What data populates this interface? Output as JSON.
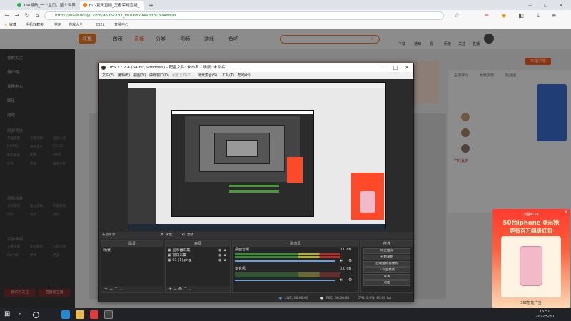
{
  "browser": {
    "tabs": [
      {
        "label": "360导航_一个主页，整个世界"
      },
      {
        "label": "YTG夏天直播_王者荣耀直播_"
      }
    ],
    "url": "https://www.douyu.com/96067787_r=0.68774933303248818",
    "bookmarks": [
      "收藏",
      "手机收藏夹",
      "常用",
      "游戏大全",
      "2021",
      "直播中心"
    ]
  },
  "douyu": {
    "logo": "斗鱼",
    "nav": [
      "首页",
      "直播",
      "分类",
      "视频",
      "游戏",
      "鱼吧"
    ],
    "active_nav": "直播",
    "header_right": [
      "下载",
      "通知",
      "看",
      "历史",
      "关注",
      "直播"
    ],
    "sidebar": {
      "top_items": [
        "我的关注",
        "排行榜",
        "兑换中心",
        "娱乐",
        "游戏"
      ],
      "section1_title": "网游竞技",
      "section1_games": [
        "英雄联盟",
        "王者荣耀",
        "穿越火线",
        "DOTA2",
        "绝地求生",
        "CS:GO",
        "和平精英",
        "DNF",
        "APEX",
        "吃鸡",
        "传奇",
        "魔兽世界"
      ],
      "section2_title": "单机热游",
      "section2_games": [
        "主机游戏",
        "独立游戏",
        "怀旧游戏",
        "单机",
        "动作",
        "冒险"
      ],
      "section3_title": "手游休闲",
      "section3_games": [
        "王者荣耀",
        "和平精英",
        "火影忍者",
        "QQ飞车",
        "原神",
        "更多"
      ],
      "bottom_buttons": [
        "我的已关注",
        "直播找主播"
      ]
    },
    "right_panel": {
      "tabs": [
        "主播排行",
        "贡献周榜",
        "粉丝团"
      ],
      "chat_user": "YTG夏天",
      "badge": "PC客户端"
    }
  },
  "obs": {
    "title": "OBS 27.2.4 (64-bit, windows) - 配置文件: 未命名 - 场景: 未命名",
    "menu": [
      "文件(F)",
      "编辑(E)",
      "视图(V)",
      "停靠窗口(D)",
      "配置文件(P)",
      "场景集合(S)",
      "工具(T)",
      "帮助(H)"
    ],
    "status_label": "未选择源",
    "props_label": "属性",
    "filters_label": "滤镜",
    "docks": {
      "scenes": {
        "title": "场景",
        "items": [
          "场景"
        ]
      },
      "sources": {
        "title": "来源",
        "items": [
          "显示器采集",
          "窗口采集",
          "01 (1).png"
        ]
      },
      "mixer": {
        "title": "混音器",
        "channels": [
          {
            "name": "桌面音频",
            "level": "0.0 dB"
          },
          {
            "name": "麦克风",
            "level": "0.0 dB"
          }
        ]
      },
      "transitions": {
        "title": "转场"
      },
      "controls": {
        "title": "控件",
        "buttons": [
          "停止推流",
          "开始录制",
          "启动虚拟摄像机",
          "工作室模式",
          "设置",
          "退出"
        ]
      }
    },
    "statusbar": {
      "live": "LIVE: 00:00:00",
      "rec": "REC: 00:00:00",
      "cpu": "CPU: 0.0%, 60.00 fps"
    }
  },
  "ad": {
    "brand": "天猫6·18",
    "headline": "50台iphone 0元抢",
    "subline": "更有百万超级红包",
    "footer": "360智能广告"
  },
  "taskbar": {
    "time": "15:51",
    "date": "2022/5/30"
  }
}
